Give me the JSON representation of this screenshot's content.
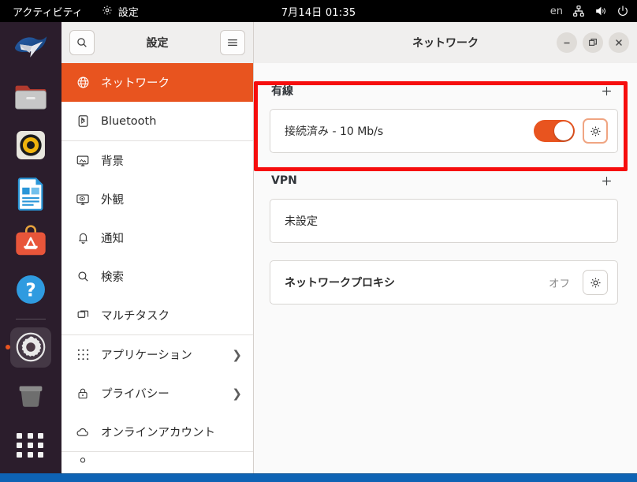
{
  "topbar": {
    "activities": "アクティビティ",
    "app_menu": "設定",
    "app_menu_icon": "settings-gear-icon",
    "clock": "7月14日 01:35",
    "keyboard_layout": "en",
    "icons": [
      "network-wired-icon",
      "volume-icon",
      "power-icon"
    ]
  },
  "dock": {
    "items": [
      {
        "name": "thunderbird",
        "label": "Thunderbird"
      },
      {
        "name": "files",
        "label": "ファイル"
      },
      {
        "name": "rhythmbox",
        "label": "Rhythmbox"
      },
      {
        "name": "libreoffice-writer",
        "label": "LibreOffice Writer"
      },
      {
        "name": "ubuntu-software",
        "label": "Ubuntu Software"
      },
      {
        "name": "help",
        "label": "ヘルプ"
      },
      {
        "name": "settings",
        "label": "設定",
        "active": true
      },
      {
        "name": "trash",
        "label": "ゴミ箱"
      }
    ],
    "show_apps": "アプリケーションを表示する"
  },
  "window": {
    "sidebar_title": "設定",
    "content_title": "ネットワーク",
    "search_icon": "search-icon",
    "menu_icon": "hamburger-menu-icon",
    "controls": {
      "minimize": "−",
      "maximize": "□",
      "close": "×"
    }
  },
  "sidebar": {
    "items": [
      {
        "label": "ネットワーク",
        "icon": "globe-icon",
        "selected": true,
        "chevron": ""
      },
      {
        "label": "Bluetooth",
        "icon": "bluetooth-icon",
        "selected": false,
        "chevron": ""
      },
      {
        "label": "背景",
        "icon": "background-icon",
        "selected": false,
        "chevron": ""
      },
      {
        "label": "外観",
        "icon": "appearance-icon",
        "selected": false,
        "chevron": ""
      },
      {
        "label": "通知",
        "icon": "bell-icon",
        "selected": false,
        "chevron": ""
      },
      {
        "label": "検索",
        "icon": "search-icon",
        "selected": false,
        "chevron": ""
      },
      {
        "label": "マルチタスク",
        "icon": "multitask-icon",
        "selected": false,
        "chevron": ""
      },
      {
        "label": "アプリケーション",
        "icon": "apps-grid-icon",
        "selected": false,
        "chevron": "❯"
      },
      {
        "label": "プライバシー",
        "icon": "lock-icon",
        "selected": false,
        "chevron": "❯"
      },
      {
        "label": "オンラインアカウント",
        "icon": "cloud-icon",
        "selected": false,
        "chevron": ""
      }
    ]
  },
  "content": {
    "wired": {
      "title": "有線",
      "add_icon": "plus-icon",
      "row_label": "接続済み - 10 Mb/s",
      "toggle_on": true,
      "settings_icon": "gear-icon"
    },
    "vpn": {
      "title": "VPN",
      "add_icon": "plus-icon",
      "row_label": "未設定"
    },
    "proxy": {
      "row_label": "ネットワークプロキシ",
      "value": "オフ",
      "settings_icon": "gear-icon"
    }
  },
  "annotation": {
    "highlight_color": "#f60d0d",
    "highlight_target": "wired-section"
  },
  "colors": {
    "accent_orange": "#e8541f",
    "topbar_black": "#000000",
    "dock_purple": "#2c1b27",
    "desktop_blue": "#0e63b4"
  }
}
